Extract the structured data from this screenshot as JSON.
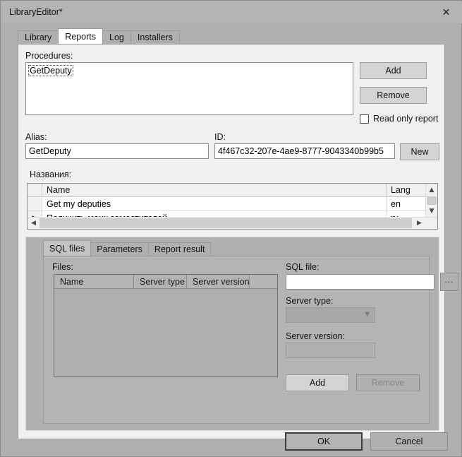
{
  "window": {
    "title": "LibraryEditor*",
    "close_icon": "close-icon"
  },
  "tabs": [
    {
      "label": "Library",
      "active": false
    },
    {
      "label": "Reports",
      "active": true
    },
    {
      "label": "Log",
      "active": false
    },
    {
      "label": "Installers",
      "active": false
    }
  ],
  "reports": {
    "procedures_label": "Procedures:",
    "procedures_items": [
      "GetDeputy"
    ],
    "add_button": "Add",
    "remove_button": "Remove",
    "read_only_checkbox": "Read only report",
    "alias_label": "Alias:",
    "alias_value": "GetDeputy",
    "id_label": "ID:",
    "id_value": "4f467c32-207e-4ae9-8777-9043340b99b5",
    "new_button": "New",
    "names_label": "Названия:",
    "names_grid": {
      "columns": [
        "Name",
        "Lang"
      ],
      "rows": [
        {
          "marker": "",
          "name": "Get my deputies",
          "lang": "en"
        },
        {
          "marker": "▶",
          "name": "Получить моих заместителей",
          "lang": "ru"
        }
      ]
    },
    "hscroll_left_icon": "chevron-left-icon",
    "hscroll_right_icon": "chevron-right-icon",
    "vscroll_up_icon": "chevron-up-icon",
    "vscroll_down_icon": "chevron-down-icon"
  },
  "bottom": {
    "tabs": [
      {
        "label": "SQL files",
        "active": true
      },
      {
        "label": "Parameters",
        "active": false
      },
      {
        "label": "Report result",
        "active": false
      }
    ],
    "files_label": "Files:",
    "files_columns": [
      "Name",
      "Server type",
      "Server version"
    ],
    "files_rows": [],
    "sql_file_label": "SQL file:",
    "sql_file_value": "",
    "browse_button": "...",
    "server_type_label": "Server type:",
    "server_type_value": "",
    "server_version_label": "Server version:",
    "server_version_value": "",
    "add_button": "Add",
    "remove_button": "Remove"
  },
  "footer": {
    "ok_button": "OK",
    "cancel_button": "Cancel"
  },
  "colors": {
    "window_bg": "#b0b0b0",
    "panel_bg": "#f0f0f0",
    "field_bg": "#ffffff",
    "button_bg": "#d4d4d4",
    "border": "#8c8c8c",
    "disabled_text": "#888888"
  }
}
